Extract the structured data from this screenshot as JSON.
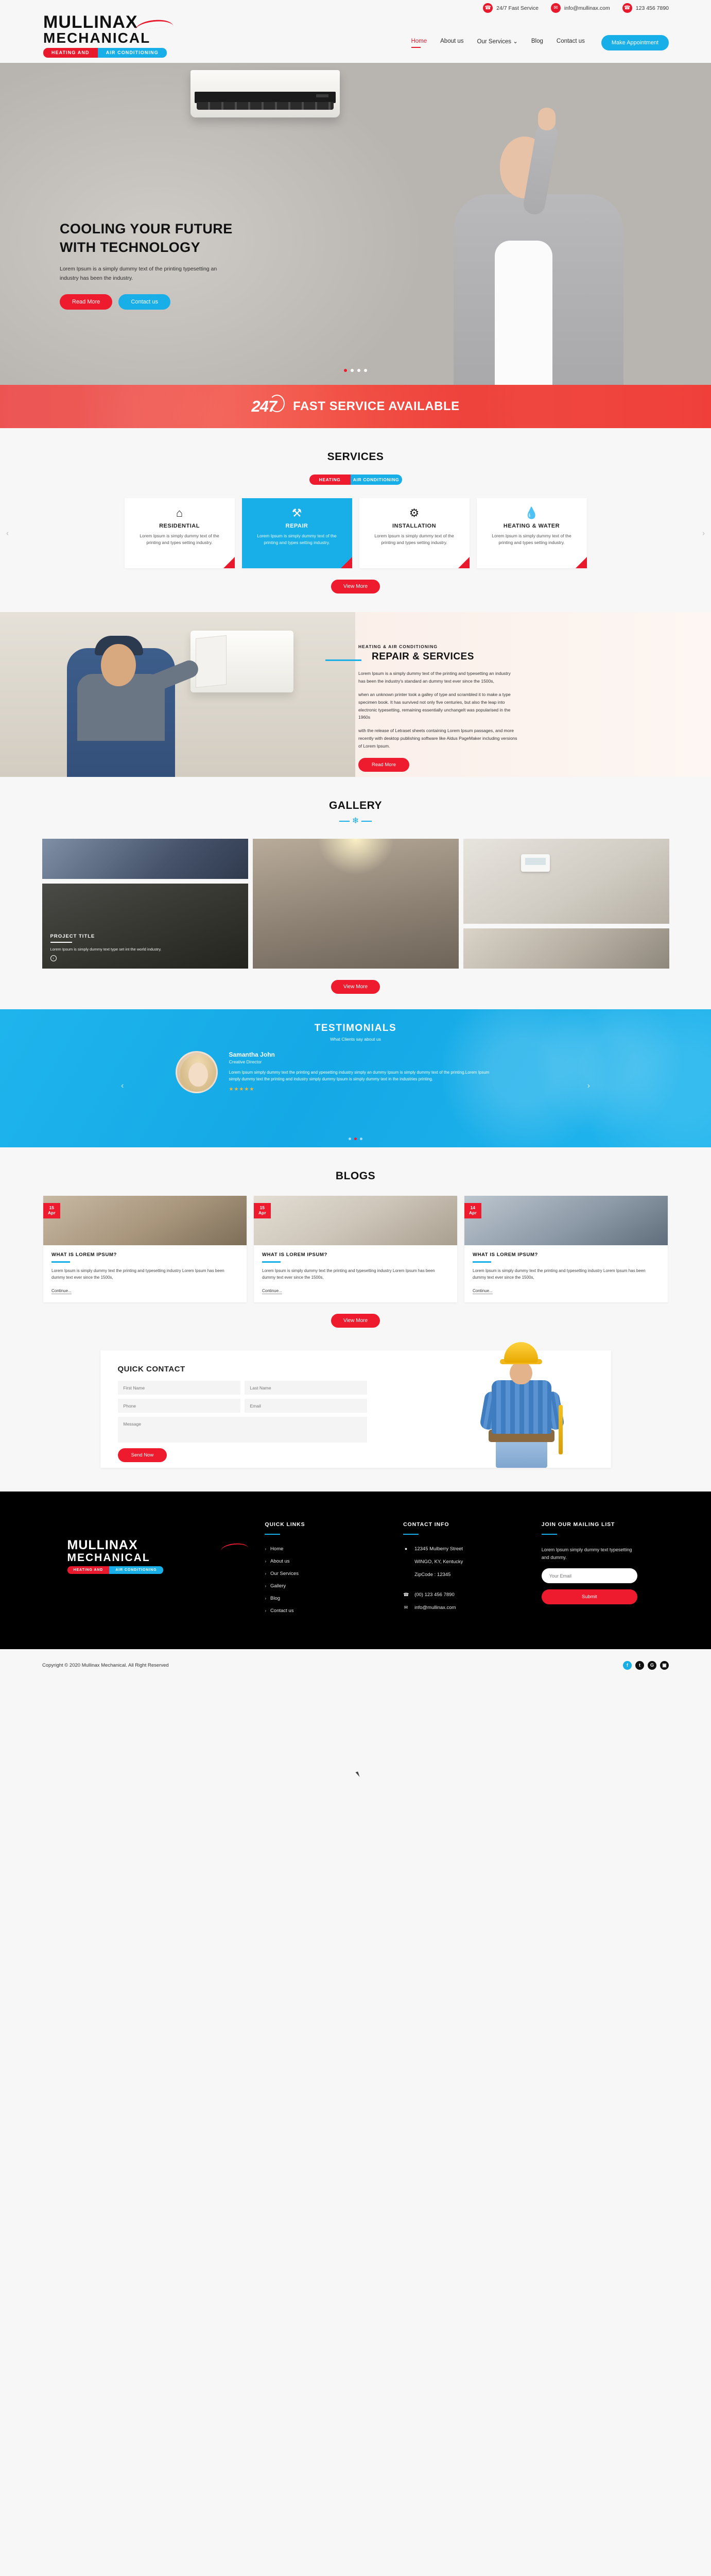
{
  "header": {
    "logo": {
      "line1": "MULLINAX",
      "line2": "MECHANICAL",
      "tag_red": "HEATING AND",
      "tag_blue": "AIR CONDITIONING"
    },
    "topinfo": [
      {
        "icon": "phone-icon",
        "text": "24/7 Fast Service"
      },
      {
        "icon": "mail-icon",
        "text": "info@mullinax.com"
      },
      {
        "icon": "phone-icon",
        "text": "123 456 7890"
      }
    ],
    "nav": [
      {
        "label": "Home",
        "active": true
      },
      {
        "label": "About us",
        "active": false
      },
      {
        "label": "Our Services",
        "active": false,
        "caret": "⌄"
      },
      {
        "label": "Blog",
        "active": false
      },
      {
        "label": "Contact us",
        "active": false
      }
    ],
    "appointment_button": "Make Appointment"
  },
  "hero": {
    "title_line1": "COOLING YOUR FUTURE",
    "title_line2": "WITH TECHNOLOGY",
    "paragraph": "Lorem Ipsum is a simply dummy text of the printing typesetting an industry has been the industry.",
    "btn_primary": "Read More",
    "btn_secondary": "Contact us",
    "slide_count": 4,
    "active_slide": 1
  },
  "banner247": {
    "number": "247",
    "text": "FAST SERVICE AVAILABLE"
  },
  "services": {
    "title": "SERVICES",
    "toggle": {
      "left": "HEATING",
      "right": "AIR CONDITIONING"
    },
    "cards": [
      {
        "icon": "home-icon",
        "glyph": "⌂",
        "name": "RESIDENTIAL",
        "desc": "Lorem Ipsum is simply dummy text of the printing and types setting industry.",
        "active": false
      },
      {
        "icon": "tools-icon",
        "glyph": "⚒",
        "name": "REPAIR",
        "desc": "Lorem Ipsum is simply dummy text of the printing and types setting industry.",
        "active": true
      },
      {
        "icon": "gear-icon",
        "glyph": "⚙",
        "name": "INSTALLATION",
        "desc": "Lorem Ipsum is simply dummy text of the printing and types setting industry.",
        "active": false
      },
      {
        "icon": "water-drop-icon",
        "glyph": "Ὂ7",
        "name": "HEATING & WATER",
        "desc": "Lorem Ipsum is simply dummy text of the printing and types setting industry.",
        "active": false
      }
    ],
    "prev_arrow": "‹",
    "next_arrow": "›",
    "view_more": "View More"
  },
  "repair": {
    "kicker": "HEATING & AIR CONDITIONING",
    "title": "REPAIR & SERVICES",
    "p1": "Lorem Ipsum is a simply dummy text of the printing and typesetting an industry has been the industry's standard an dummy text ever since the 1500s,",
    "p2": "when an unknown printer took a galley of type and scrambled it to make a type specimen book. It has survived not only five centuries, but also the leap into electronic typesetting, remaining essentially unchangeIt was popularised in the 1960s",
    "p3": "with the release of Letraset sheets containing Lorem Ipsum passages, and more recently with desktop publishing software like Aldus PageMaker including versions of Lorem Ipsum.",
    "button": "Read More"
  },
  "gallery": {
    "title": "GALLERY",
    "project": {
      "title": "PROJECT TITLE",
      "desc": "Lorem Ipsum is simply dummy text type set int the world industry.",
      "arrow": "›"
    },
    "view_more": "View More"
  },
  "testimonials": {
    "title": "TESTIMONIALS",
    "subtitle": "What Clients say about us",
    "name": "Samantha John",
    "role": "Creative Director",
    "quote": "Lorem Ipsum  simply dummy text the printing and ypesetting industry simply an dummy Ipsum is simply dummy text of the printing.Lorem Ipsum  simply dummy text the printing and industry  simply dummy Ipsum is simply dummy text in the industries printing.",
    "stars": "★★★★★",
    "prev_arrow": "‹",
    "next_arrow": "›",
    "slide_count": 3,
    "active_slide": 2
  },
  "blogs": {
    "title": "BLOGS",
    "posts": [
      {
        "day": "15",
        "month": "Apr",
        "title": "WHAT IS LOREM IPSUM?",
        "excerpt": "Lorem Ipsum is simply dummy text the printing and typesetting industry Lorem Ipsum has been dummy text ever since the 1500s,",
        "link": "Continue..."
      },
      {
        "day": "15",
        "month": "Apr",
        "title": "WHAT IS LOREM IPSUM?",
        "excerpt": "Lorem Ipsum is simply dummy text the printing and typesetting industry Lorem Ipsum has been dummy text ever since the 1500s,",
        "link": "Continue..."
      },
      {
        "day": "14",
        "month": "Apr",
        "title": "WHAT IS LOREM IPSUM?",
        "excerpt": "Lorem Ipsum is simply dummy text the printing and typesetting industry Lorem Ipsum has been dummy text ever since the 1500s,",
        "link": "Continue..."
      }
    ],
    "view_more": "View More"
  },
  "quick_contact": {
    "title": "QUICK CONTACT",
    "first_name_placeholder": "First Name",
    "last_name_placeholder": "Last Name",
    "phone_placeholder": "Phone",
    "email_placeholder": "Email",
    "message_placeholder": "Message",
    "send_button": "Send Now"
  },
  "footer": {
    "logo": {
      "line1": "MULLINAX",
      "line2": "MECHANICAL",
      "tag_red": "HEATING AND",
      "tag_blue": "AIR CONDITIONING"
    },
    "quick_links": {
      "title": "QUICK LINKS",
      "items": [
        "Home",
        "About us",
        "Our Services",
        "Gallery",
        "Blog",
        "Contact us"
      ]
    },
    "contact_info": {
      "title": "CONTACT INFO",
      "address_line1": "12345  Mulberry Street",
      "address_line2": "WINGO, KY, Kentucky",
      "address_line3": "ZipCode : 12345",
      "phone": "(00) 123 456 7890",
      "email": "info@mullinax.com"
    },
    "mailing": {
      "title": "JOIN OUR MAILING LIST",
      "text": "Lorem Ipsum  simply dummy text typesetting and dummy.",
      "placeholder": "Your Email",
      "button": "Submit"
    },
    "copyright": "Copyright © 2020 Mullinax Mechanical. All Right Reserved",
    "socials": [
      {
        "name": "facebook-icon",
        "glyph": "f"
      },
      {
        "name": "twitter-icon",
        "glyph": "t"
      },
      {
        "name": "google-plus-icon",
        "glyph": "G"
      },
      {
        "name": "instagram-icon",
        "glyph": "▣"
      }
    ]
  },
  "colors": {
    "red": "#ee1b2e",
    "blue": "#18AEE8",
    "dark": "#111111"
  }
}
